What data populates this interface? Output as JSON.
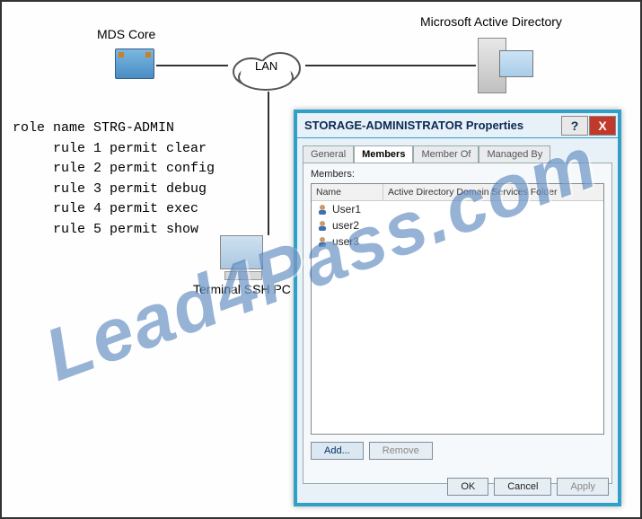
{
  "labels": {
    "mds": "MDS Core",
    "lan": "LAN",
    "ad": "Microsoft Active Directory",
    "terminal": "Terminal SSH PC"
  },
  "config": {
    "role_line": "role name STRG-ADMIN",
    "rules": [
      "rule 1 permit clear",
      "rule 2 permit config",
      "rule 3 permit debug",
      "rule 4 permit exec",
      "rule 5 permit show"
    ]
  },
  "dialog": {
    "title": "STORAGE-ADMINISTRATOR Properties",
    "help_glyph": "?",
    "close_glyph": "X",
    "tabs": {
      "general": "General",
      "members": "Members",
      "member_of": "Member Of",
      "managed_by": "Managed By"
    },
    "members_label": "Members:",
    "columns": {
      "name": "Name",
      "folder": "Active Directory Domain Services Folder"
    },
    "users": [
      "User1",
      "user2",
      "user3"
    ],
    "buttons": {
      "add": "Add...",
      "remove": "Remove",
      "ok": "OK",
      "cancel": "Cancel",
      "apply": "Apply"
    }
  },
  "watermark": "Lead4Pass.com"
}
